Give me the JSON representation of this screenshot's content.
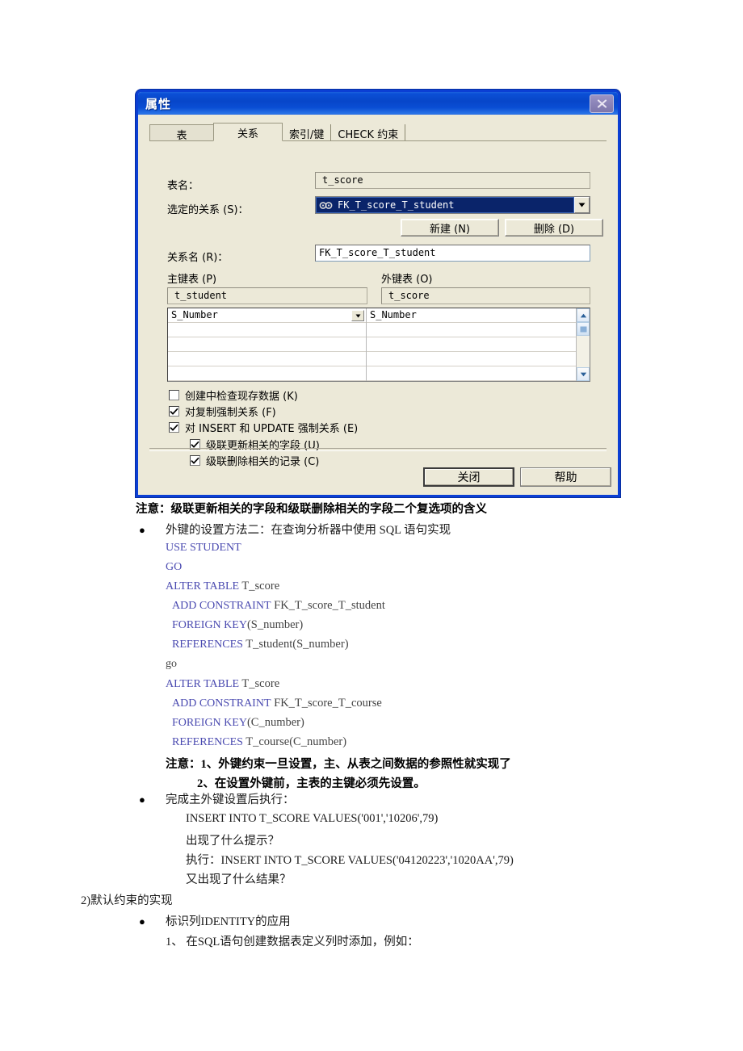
{
  "dialog": {
    "title": "属性",
    "close_icon": "close-icon",
    "tabs": [
      {
        "label": "表",
        "active": false
      },
      {
        "label": "关系",
        "active": true
      },
      {
        "label": "索引/键",
        "active": false
      },
      {
        "label": "CHECK 约束",
        "active": false
      }
    ],
    "fields": {
      "table_name_label": "表名：",
      "table_name_value": "t_score",
      "selected_relation_label": "选定的关系 (S)：",
      "selected_relation_value": "FK_T_score_T_student",
      "relation_name_label": "关系名 (R)：",
      "relation_name_value": "FK_T_score_T_student",
      "primary_table_label": "主键表 (P)",
      "primary_table_value": "t_student",
      "foreign_table_label": "外键表 (O)",
      "foreign_table_value": "t_score"
    },
    "buttons": {
      "new_label": "新建 (N)",
      "delete_label": "删除 (D)",
      "close_label": "关闭",
      "help_label": "帮助"
    },
    "grid": {
      "primary_rows": [
        "S_Number",
        "",
        "",
        "",
        ""
      ],
      "foreign_rows": [
        "S_Number",
        "",
        "",
        "",
        ""
      ]
    },
    "checkboxes": [
      {
        "label": "创建中检查现存数据 (K)",
        "checked": false,
        "indent": 0
      },
      {
        "label": "对复制强制关系 (F)",
        "checked": true,
        "indent": 0
      },
      {
        "label": "对 INSERT 和 UPDATE 强制关系 (E)",
        "checked": true,
        "indent": 0
      },
      {
        "label": "级联更新相关的字段 (U)",
        "checked": true,
        "indent": 1
      },
      {
        "label": "级联删除相关的记录 (C)",
        "checked": true,
        "indent": 1
      }
    ],
    "colors": {
      "titlebar": "#0b4fd6",
      "face": "#ece9d8",
      "border": "#0b3fd4",
      "selection": "#0a246a"
    }
  },
  "document": {
    "note1": "注意：级联更新相关的字段和级联删除相关的字段二个复选项的含义",
    "bullet1": "外键的设置方法二：在查询分析器中使用 SQL 语句实现",
    "sql_block_1": [
      {
        "kw": "USE  STUDENT",
        "id": ""
      },
      {
        "kw": "GO",
        "id": ""
      },
      {
        "kw": "ALTER  TABLE",
        "id": " T_score"
      },
      {
        "kw": "ADD  CONSTRAINT",
        "id": " FK_T_score_T_student"
      },
      {
        "kw": "FOREIGN  KEY",
        "id": "(S_number)"
      },
      {
        "kw": "REFERENCES",
        "id": " T_student(S_number)"
      }
    ],
    "go_line": "go",
    "sql_block_2": [
      {
        "kw": "ALTER  TABLE",
        "id": "  T_score"
      },
      {
        "kw": "ADD  CONSTRAINT",
        "id": " FK_T_score_T_course"
      },
      {
        "kw": "FOREIGN  KEY",
        "id": "(C_number)"
      },
      {
        "kw": "REFERENCES",
        "id": "  T_course(C_number)"
      }
    ],
    "note2_line1": "注意：1、外键约束一旦设置，主、从表之间数据的参照性就实现了",
    "note2_line2": "2、在设置外键前，主表的主键必须先设置。",
    "bullet2": "完成主外键设置后执行：",
    "exec_line1": "INSERT INTO   T_SCORE   VALUES('001','10206',79)",
    "exec_line2": "出现了什么提示？",
    "exec_line3": "执行：INSERT INTO   T_SCORE   VALUES('04120223','1020AA',79)",
    "exec_line4": "又出现了什么结果？",
    "section2": "2)默认约束的实现",
    "bullet3": "标识列IDENTITY的应用",
    "sub1": "1、 在SQL语句创建数据表定义列时添加，例如："
  }
}
